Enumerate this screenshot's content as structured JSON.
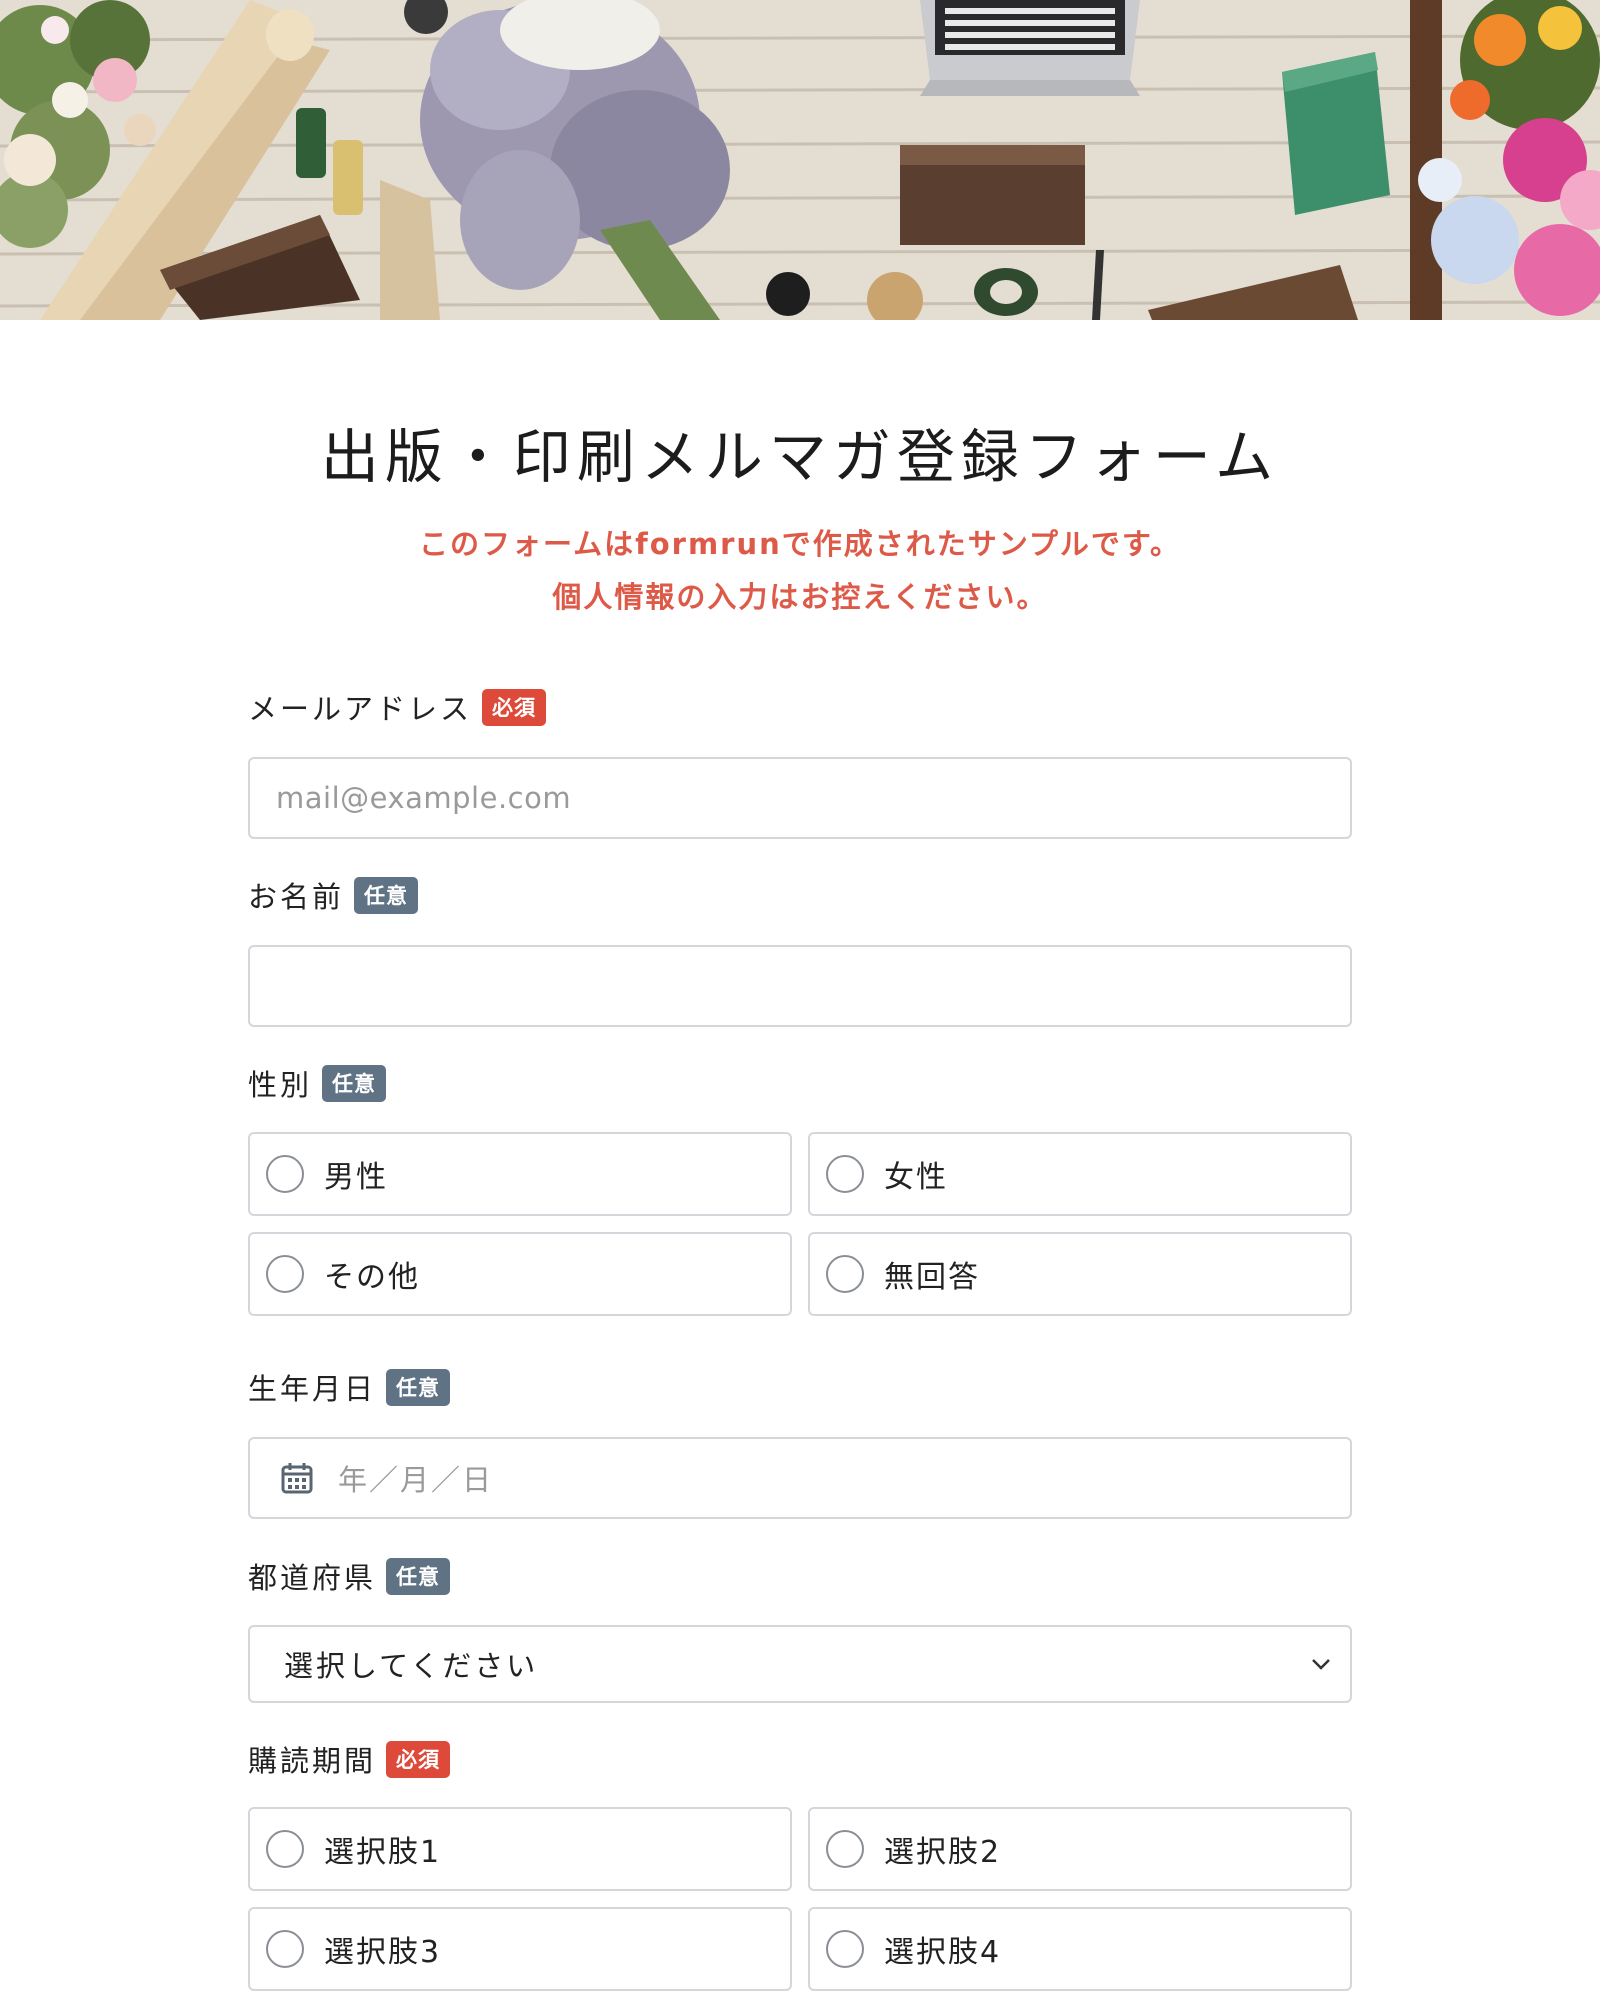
{
  "title": "出版・印刷メルマガ登録フォーム",
  "notice": {
    "line1": "このフォームはformrunで作成されたサンプルです。",
    "line2": "個人情報の入力はお控えください。"
  },
  "badges": {
    "required": "必須",
    "optional": "任意"
  },
  "email": {
    "label": "メールアドレス",
    "placeholder": "mail@example.com"
  },
  "name": {
    "label": "お名前",
    "value": ""
  },
  "gender": {
    "label": "性別",
    "options": [
      "男性",
      "女性",
      "その他",
      "無回答"
    ]
  },
  "birthday": {
    "label": "生年月日",
    "placeholder": "年／月／日"
  },
  "prefecture": {
    "label": "都道府県",
    "selected": "選択してください"
  },
  "period": {
    "label": "購読期間",
    "options": [
      "選択肢1",
      "選択肢2",
      "選択肢3",
      "選択肢4"
    ]
  },
  "colors": {
    "required_badge": "#dd4a3a",
    "optional_badge": "#5f7385",
    "notice_text": "#de5a48",
    "border": "#d3d6da"
  }
}
